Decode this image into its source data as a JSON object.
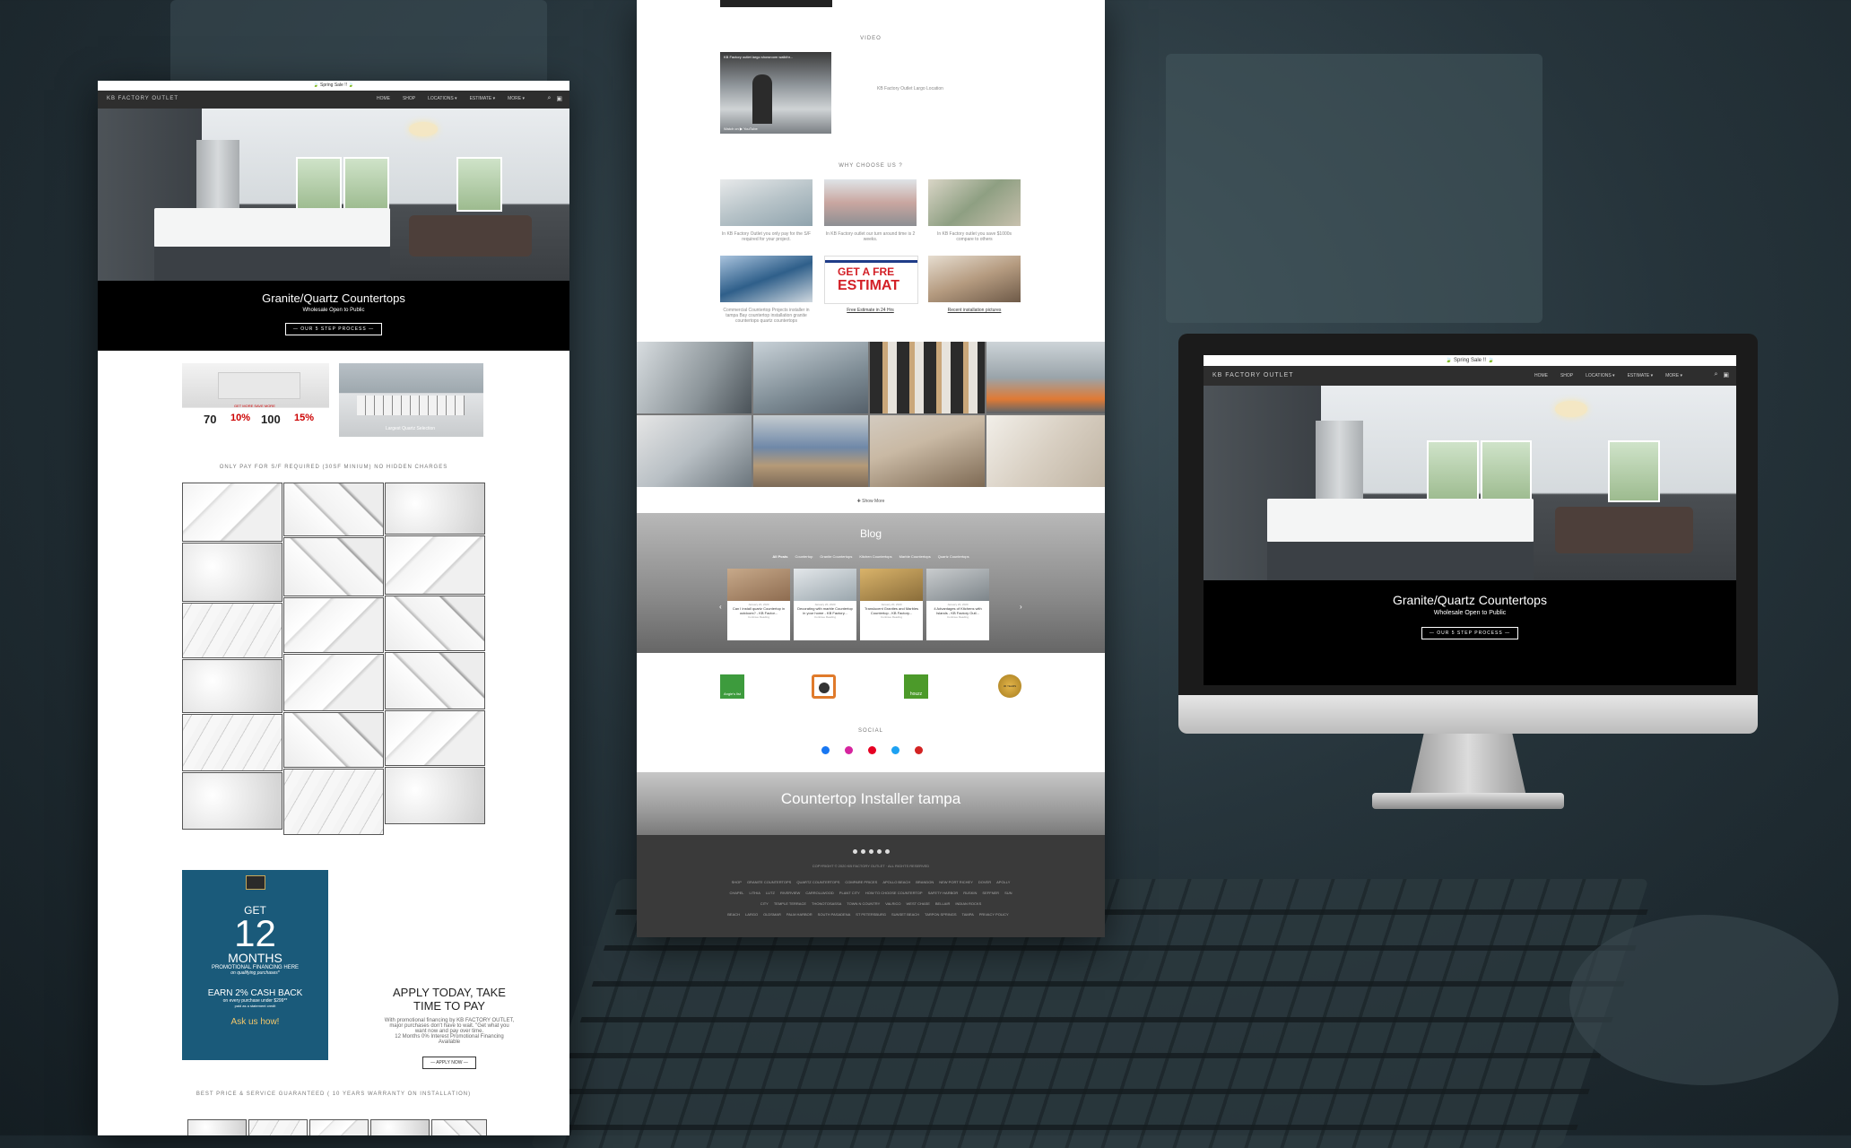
{
  "left_page": {
    "announcement": "🍃 Spring Sale !! 🍃",
    "brand": "KB FACTORY OUTLET",
    "nav": [
      "HOME",
      "SHOP",
      "LOCATIONS ▾",
      "ESTIMATE ▾",
      "MORE ▾"
    ],
    "hero": {
      "title": "Granite/Quartz Countertops",
      "subtitle": "Wholesale Open to Public",
      "button": "— OUR 5 STEP PROCESS —"
    },
    "promo_banner": {
      "line1": "GET MORE  SAVE MORE",
      "offer1_amount": "70",
      "offer1_pct": "10%",
      "offer2_amount": "100",
      "offer2_pct": "15%"
    },
    "warehouse_caption": "Largest Quartz Selection",
    "slabs_heading": "ONLY PAY FOR S/F REQUIRED (30SF MINIUM) NO HIDDEN CHARGES",
    "financing_card": {
      "get": "GET",
      "number": "12",
      "months": "MONTHS",
      "promo": "PROMOTIONAL FINANCING HERE",
      "qualify": "on qualifying purchases*",
      "cashback": "EARN 2% CASH BACK",
      "cashback_sub": "on every purchase under $299**",
      "cashback_sub2": "paid as a statement credit",
      "ask": "Ask us how!"
    },
    "apply": {
      "title_line1": "APPLY TODAY, TAKE",
      "title_line2": "TIME TO PAY",
      "body1": "With promotional financing by KB FACTORY OUTLET,",
      "body2": "major purchases don't have to wait. \"Get what you",
      "body3": "want now and pay over time.",
      "body4": "12 Months 0% Interest Promotional  Financing",
      "body5": "Available",
      "button": "— APPLY NOW —"
    },
    "warranty_heading": "BEST PRICE & SERVICE GUARANTEED ( 10 YEARS WARRANTY ON INSTALLATION)"
  },
  "middle_page": {
    "video_heading": "VIDEO",
    "video_title": "KB Factory outlet largo showroom walkthr...",
    "video_watch": "Watch on ▶ YouTube",
    "video_caption": "KB Factory Outlet Largo Location",
    "why_heading": "WHY CHOOSE US ?",
    "why_items": [
      {
        "text": "In KB Factory Outlet you only pay for the S/F required for your project."
      },
      {
        "text": "In KB Factory outlet our turn around time is 2 weeks."
      },
      {
        "text": "In KB Factory outlet you save $1000s compare to others"
      },
      {
        "text": "Commercial Countertop Projects installer in tampa Bay countertop installation granite countertops quartz countertops"
      },
      {
        "text": "Free Estimate in 24 Hrs"
      },
      {
        "text": "Recent installation pictures"
      }
    ],
    "estimate_graphic": {
      "line1": "GET A FRE",
      "line2": "ESTIMAT"
    },
    "show_more": "✚ Show More",
    "blog": {
      "title": "Blog",
      "filters": [
        "All Posts",
        "Countertop",
        "Granite Countertops",
        "Kitchen Countertops",
        "Marble Countertops",
        "Quartz Countertops"
      ],
      "posts": [
        {
          "date": "January 20, 2020",
          "title": "Can I install quartz Countertop in outdoors? - KB Factor...",
          "link": "Continue Reading"
        },
        {
          "date": "January 20, 2020",
          "title": "Decorating with marble Countertop in your home - KB Factory...",
          "link": "Continue Reading"
        },
        {
          "date": "January 20, 2020",
          "title": "Translucent Granites and Marbles Countertop - KB Factory...",
          "link": "Continue Reading"
        },
        {
          "date": "January 20, 2020",
          "title": "4 Advantages of Kitchens with Islands - KB Factory Outl...",
          "link": "Continue Reading"
        }
      ]
    },
    "badges": [
      "Angie's list",
      "",
      "houzz",
      "30 YEARS"
    ],
    "social_heading": "SOCIAL",
    "installer_banner": "Countertop Installer tampa",
    "copyright": "COPYRIGHT © 2020 KB FACTORY OUTLET  ·  ALL RIGHTS RESERVED",
    "footer_links": [
      "SHOP",
      "GRANITE COUNTERTOPS",
      "QUARTZ COUNTERTOPS",
      "COMPARE PRICES",
      "APOLLO BEACH",
      "BRANDON",
      "NEW PORT RICHEY",
      "DOVER",
      "APOLLY CHAPEL",
      "LITHIA",
      "LUTZ",
      "RIVERVIEW",
      "CARROLLWOOD",
      "PLANT CITY",
      "HOW TO CHOOSE COUNTERTOP",
      "SAFETY HARBOR",
      "RUSKIN",
      "SEFFNER",
      "SUN CITY",
      "TEMPLE TERRACE",
      "THONOTOSASSA",
      "TOWN N COUNTRY",
      "VALRICO",
      "WEST CHASE",
      "BELLAIR",
      "INDIAN ROCKS BEACH",
      "LARGO",
      "OLDSMAR",
      "PALM HARBOR",
      "SOUTH PASADENA",
      "ST PETERSBURG",
      "SUNSET BEACH",
      "TARPON SPRINGS",
      "TAMPA",
      "PRIVACY POLICY"
    ]
  },
  "monitor_page": {
    "announcement": "🍃 Spring Sale !! 🍃",
    "brand": "KB FACTORY OUTLET",
    "nav": [
      "HOME",
      "SHOP",
      "LOCATIONS ▾",
      "ESTIMATE ▾",
      "MORE ▾"
    ],
    "hero_title": "Granite/Quartz Countertops",
    "hero_subtitle": "Wholesale Open to Public",
    "hero_button": "— OUR 5 STEP PROCESS —"
  },
  "colors": {
    "nav_bg": "#2e2e2e",
    "hero_caption_bg": "#000000",
    "financing_bg": "#1a5a7a",
    "estimate_red": "#d32027",
    "footer_bg": "#3a3a3a"
  }
}
